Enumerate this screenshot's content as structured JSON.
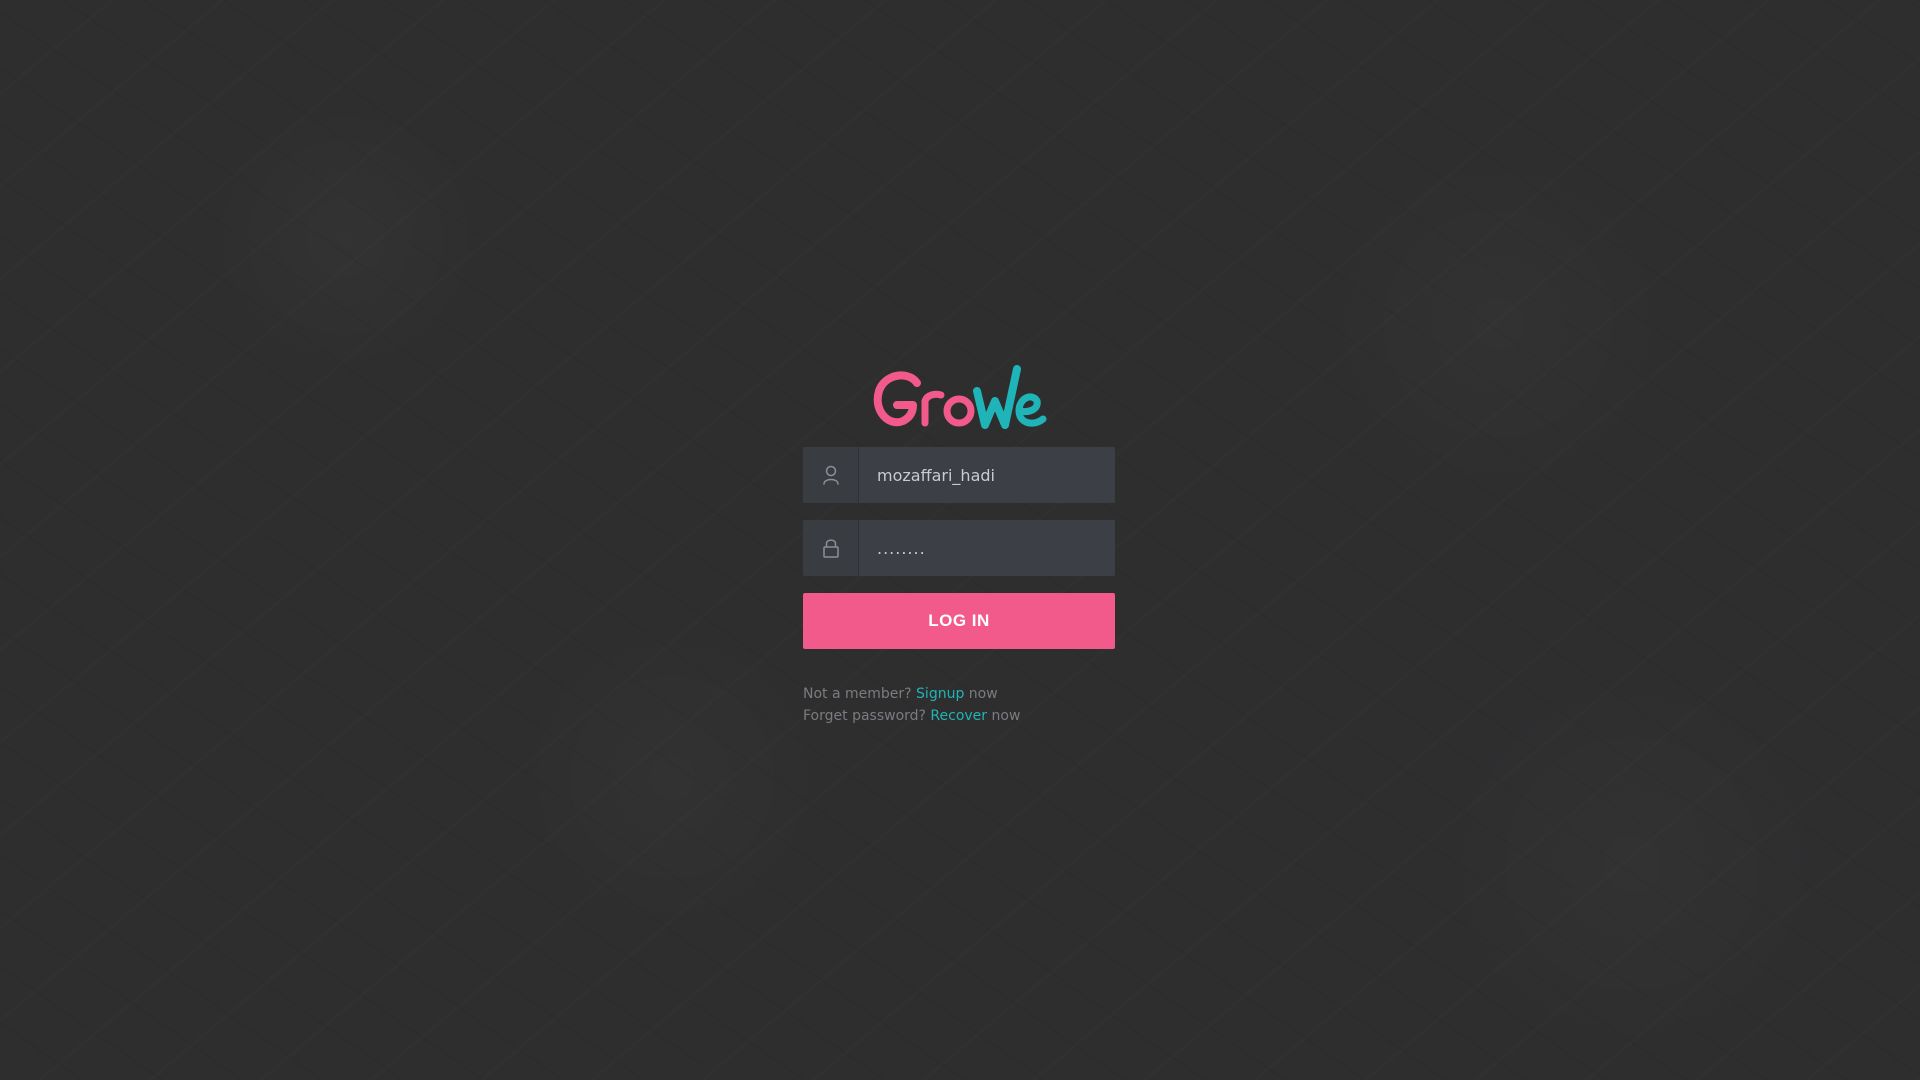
{
  "brand": {
    "logo_text": "GroWe",
    "logo_part_1": "Gro",
    "logo_part_2": "We",
    "colors": {
      "pink": "#f25a8b",
      "teal": "#1fb5b8"
    }
  },
  "login": {
    "username_icon": "user-icon",
    "password_icon": "lock-icon",
    "username_value": "mozaffari_hadi",
    "password_value": "........",
    "button_label": "LOG IN"
  },
  "links": {
    "signup_prefix": "Not a member?",
    "signup_link": "Signup",
    "signup_suffix": "now",
    "recover_prefix": "Forget password?",
    "recover_link": "Recover",
    "recover_suffix": "now"
  },
  "theme": {
    "background": "#2e2e2f",
    "input_background": "#3c3f46",
    "button_color": "#f25a8b",
    "link_color": "#1fb5b8",
    "muted_text": "#7a7c80"
  }
}
